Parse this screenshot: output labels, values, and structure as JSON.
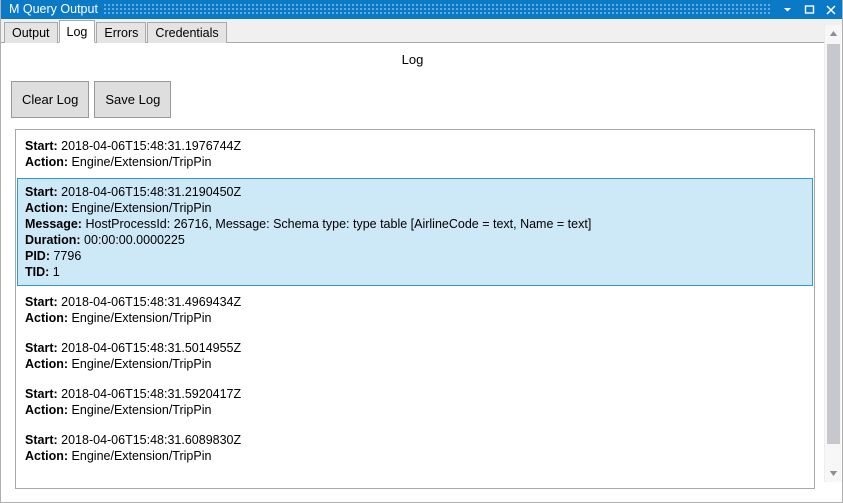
{
  "window": {
    "title": "M Query Output",
    "controls": [
      {
        "name": "minimize-button",
        "label": "▾"
      },
      {
        "name": "maximize-button",
        "label": "□"
      },
      {
        "name": "close-button",
        "label": "✕"
      }
    ],
    "colors": {
      "titlebar": "#0a7ac7",
      "titlebar_text": "#ffffff",
      "selection": "#cde8f6",
      "selection_border": "#3399cc",
      "button_face": "#dedede",
      "panel_border": "#a9a9a9"
    }
  },
  "tabs": [
    {
      "label": "Output",
      "selected": false
    },
    {
      "label": "Log",
      "selected": true
    },
    {
      "label": "Errors",
      "selected": false
    },
    {
      "label": "Credentials",
      "selected": false
    }
  ],
  "page": {
    "title": "Log"
  },
  "toolbar": {
    "clear_label": "Clear Log",
    "save_label": "Save Log"
  },
  "log": {
    "entries": [
      {
        "selected": false,
        "lines": [
          {
            "key": "Start:",
            "value": "2018-04-06T15:48:31.1976744Z"
          },
          {
            "key": "Action:",
            "value": "Engine/Extension/TripPin"
          }
        ]
      },
      {
        "selected": true,
        "lines": [
          {
            "key": "Start:",
            "value": "2018-04-06T15:48:31.2190450Z"
          },
          {
            "key": "Action:",
            "value": "Engine/Extension/TripPin"
          },
          {
            "key": "Message:",
            "value": "HostProcessId: 26716, Message: Schema type: type table [AirlineCode = text, Name = text]"
          },
          {
            "key": "Duration:",
            "value": "00:00:00.0000225"
          },
          {
            "key": "PID:",
            "value": "7796"
          },
          {
            "key": "TID:",
            "value": "1"
          }
        ]
      },
      {
        "selected": false,
        "lines": [
          {
            "key": "Start:",
            "value": "2018-04-06T15:48:31.4969434Z"
          },
          {
            "key": "Action:",
            "value": "Engine/Extension/TripPin"
          }
        ]
      },
      {
        "selected": false,
        "lines": [
          {
            "key": "Start:",
            "value": "2018-04-06T15:48:31.5014955Z"
          },
          {
            "key": "Action:",
            "value": "Engine/Extension/TripPin"
          }
        ]
      },
      {
        "selected": false,
        "lines": [
          {
            "key": "Start:",
            "value": "2018-04-06T15:48:31.5920417Z"
          },
          {
            "key": "Action:",
            "value": "Engine/Extension/TripPin"
          }
        ]
      },
      {
        "selected": false,
        "lines": [
          {
            "key": "Start:",
            "value": "2018-04-06T15:48:31.6089830Z"
          },
          {
            "key": "Action:",
            "value": "Engine/Extension/TripPin"
          }
        ]
      }
    ]
  },
  "scrollbar": {
    "up_arrow": "▲",
    "down_arrow": "▼"
  }
}
